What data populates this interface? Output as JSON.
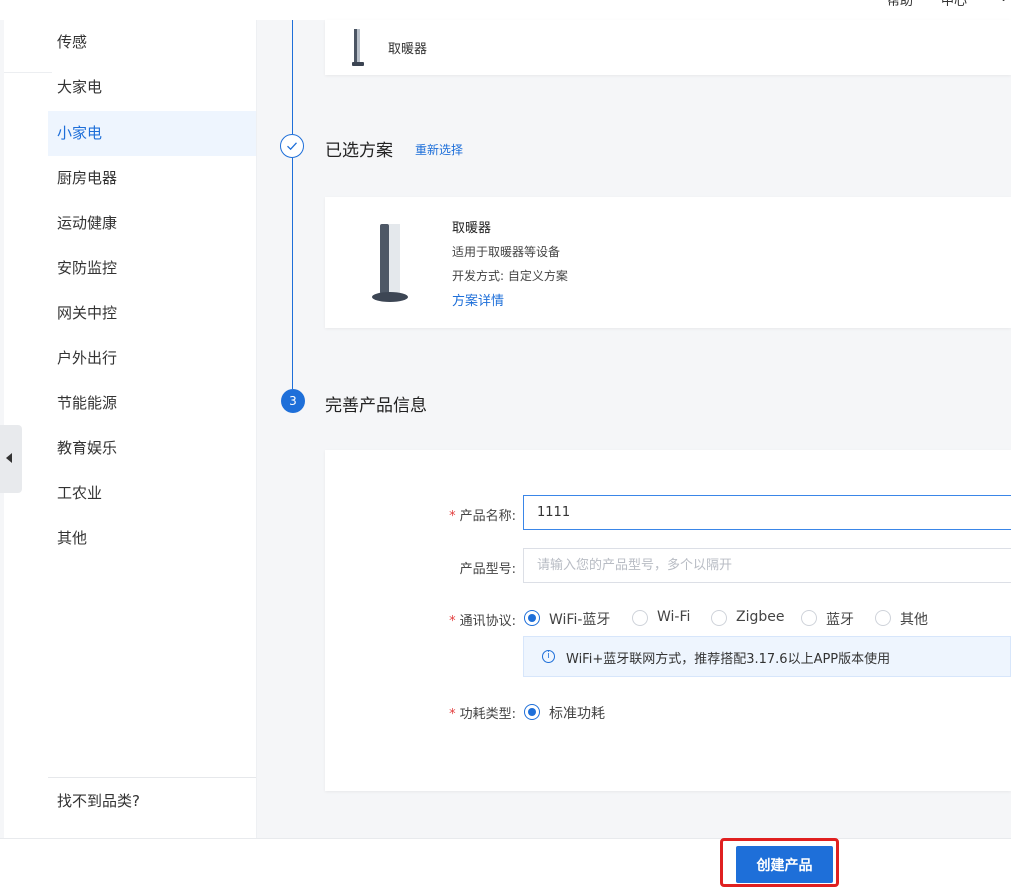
{
  "header": {
    "partial_text": [
      "帮助",
      "中心",
      "⌄"
    ]
  },
  "sidebar": {
    "items": [
      {
        "label": "传感"
      },
      {
        "label": "大家电"
      },
      {
        "label": "小家电"
      },
      {
        "label": "厨房电器"
      },
      {
        "label": "运动健康"
      },
      {
        "label": "安防监控"
      },
      {
        "label": "网关中控"
      },
      {
        "label": "户外出行"
      },
      {
        "label": "节能能源"
      },
      {
        "label": "教育娱乐"
      },
      {
        "label": "工农业"
      },
      {
        "label": "其他"
      }
    ],
    "active_index": 2,
    "not_found_label": "找不到品类?"
  },
  "top_card": {
    "product_name": "取暖器"
  },
  "selected_plan": {
    "title": "已选方案",
    "reselect_label": "重新选择",
    "name": "取暖器",
    "description": "适用于取暖器等设备",
    "dev_mode": "开发方式: 自定义方案",
    "detail_link": "方案详情"
  },
  "step3": {
    "number": "3",
    "title": "完善产品信息"
  },
  "form": {
    "product_name": {
      "required_mark": "*",
      "label": "产品名称:",
      "value": "1111"
    },
    "product_model": {
      "label": "产品型号:",
      "placeholder": "请输入您的产品型号，多个以隔开"
    },
    "protocol": {
      "required_mark": "*",
      "label": "通讯协议:",
      "options": [
        "WiFi-蓝牙",
        "Wi-Fi",
        "Zigbee",
        "蓝牙",
        "其他"
      ],
      "selected": "WiFi-蓝牙",
      "tip_icon": "i",
      "tip": "WiFi+蓝牙联网方式，推荐搭配3.17.6以上APP版本使用"
    },
    "power_type": {
      "required_mark": "*",
      "label": "功耗类型:",
      "options": [
        "标准功耗"
      ],
      "selected": "标准功耗"
    }
  },
  "footer": {
    "create_button": "创建产品"
  },
  "colors": {
    "primary": "#1e6fd9",
    "required": "#e23c3c",
    "highlight": "#e02020"
  }
}
